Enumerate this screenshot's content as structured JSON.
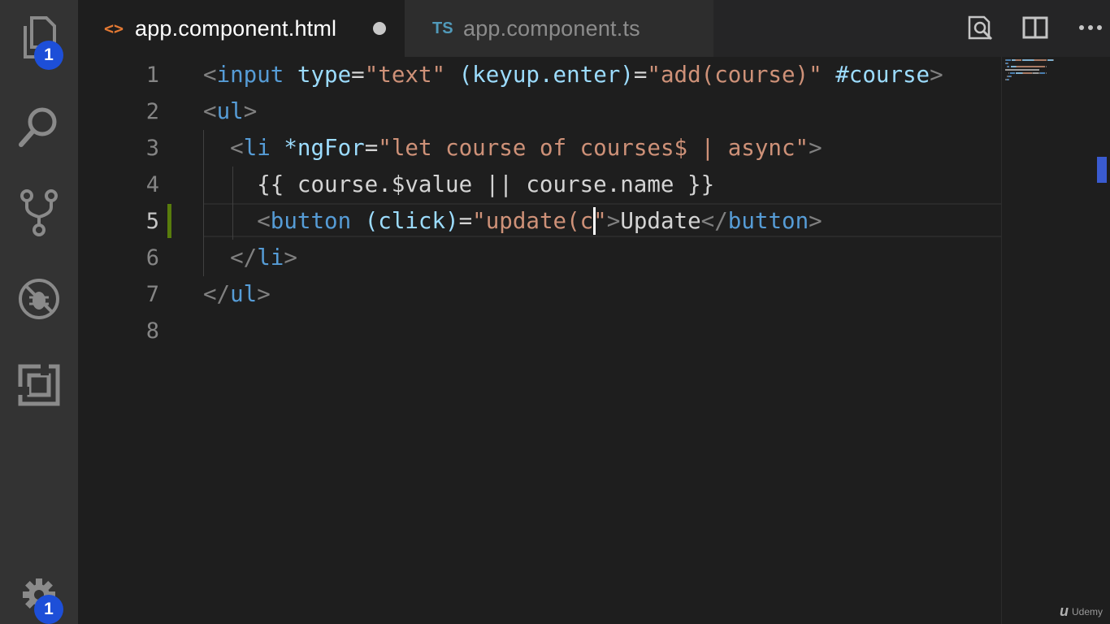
{
  "activity_bar": {
    "explorer_badge": "1",
    "settings_badge": "1"
  },
  "tabs": [
    {
      "icon": "<>",
      "label": "app.component.html",
      "dirty": true
    },
    {
      "icon": "TS",
      "label": "app.component.ts",
      "dirty": false
    }
  ],
  "editor": {
    "line_numbers": [
      "1",
      "2",
      "3",
      "4",
      "5",
      "6",
      "7",
      "8"
    ],
    "current_line": "5",
    "lines": [
      [
        {
          "t": "<",
          "c": "punc"
        },
        {
          "t": "input",
          "c": "tag"
        },
        {
          "t": " ",
          "c": "text"
        },
        {
          "t": "type",
          "c": "attr"
        },
        {
          "t": "=",
          "c": "text"
        },
        {
          "t": "\"text\"",
          "c": "str"
        },
        {
          "t": " ",
          "c": "text"
        },
        {
          "t": "(keyup.enter)",
          "c": "attr"
        },
        {
          "t": "=",
          "c": "text"
        },
        {
          "t": "\"add(course)\"",
          "c": "str"
        },
        {
          "t": " ",
          "c": "text"
        },
        {
          "t": "#course",
          "c": "attr"
        },
        {
          "t": ">",
          "c": "punc"
        }
      ],
      [
        {
          "t": "<",
          "c": "punc"
        },
        {
          "t": "ul",
          "c": "tag"
        },
        {
          "t": ">",
          "c": "punc"
        }
      ],
      [
        {
          "t": "  ",
          "c": "text"
        },
        {
          "t": "<",
          "c": "punc"
        },
        {
          "t": "li",
          "c": "tag"
        },
        {
          "t": " ",
          "c": "text"
        },
        {
          "t": "*ngFor",
          "c": "attr"
        },
        {
          "t": "=",
          "c": "text"
        },
        {
          "t": "\"let course of courses$ | async\"",
          "c": "str"
        },
        {
          "t": ">",
          "c": "punc"
        }
      ],
      [
        {
          "t": "    {{ course.$value || course.name }}",
          "c": "text"
        }
      ],
      [
        {
          "t": "    ",
          "c": "text"
        },
        {
          "t": "<",
          "c": "punc"
        },
        {
          "t": "button",
          "c": "tag"
        },
        {
          "t": " ",
          "c": "text"
        },
        {
          "t": "(click)",
          "c": "attr"
        },
        {
          "t": "=",
          "c": "text"
        },
        {
          "t": "\"update(c\"",
          "c": "str"
        },
        {
          "t": ">",
          "c": "punc"
        },
        {
          "t": "Update",
          "c": "text"
        },
        {
          "t": "</",
          "c": "punc"
        },
        {
          "t": "button",
          "c": "tag"
        },
        {
          "t": ">",
          "c": "punc"
        }
      ],
      [
        {
          "t": "  ",
          "c": "text"
        },
        {
          "t": "</",
          "c": "punc"
        },
        {
          "t": "li",
          "c": "tag"
        },
        {
          "t": ">",
          "c": "punc"
        }
      ],
      [
        {
          "t": "</",
          "c": "punc"
        },
        {
          "t": "ul",
          "c": "tag"
        },
        {
          "t": ">",
          "c": "punc"
        }
      ],
      []
    ]
  },
  "watermark": {
    "mark": "u",
    "label": "Udemy"
  },
  "colors": {
    "tag": "#569cd6",
    "attr": "#9cdcfe",
    "string": "#ce9178",
    "punctuation": "#808080",
    "badge": "#1d4fd8",
    "git_modified": "#587c0c"
  }
}
